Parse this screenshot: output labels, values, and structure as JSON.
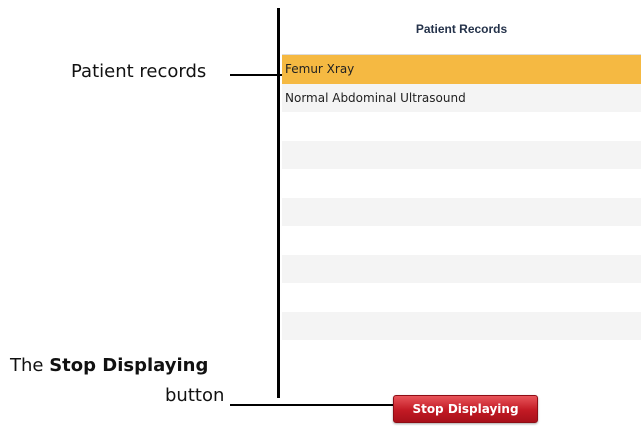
{
  "callouts": {
    "records_label": "Patient records",
    "stop_prefix": "The ",
    "stop_bold": "Stop Displaying",
    "stop_suffix": "button"
  },
  "panel": {
    "title": "Patient Records",
    "records": [
      {
        "label": "Femur Xray",
        "selected": true
      },
      {
        "label": "Normal Abdominal Ultrasound",
        "selected": false
      },
      {
        "label": "",
        "selected": false
      },
      {
        "label": "",
        "selected": false
      },
      {
        "label": "",
        "selected": false
      },
      {
        "label": "",
        "selected": false
      },
      {
        "label": "",
        "selected": false
      },
      {
        "label": "",
        "selected": false
      },
      {
        "label": "",
        "selected": false
      },
      {
        "label": "",
        "selected": false
      },
      {
        "label": "",
        "selected": false
      }
    ],
    "stop_button_label": "Stop Displaying",
    "selected_color": "#f5b942",
    "button_color": "#c21a24"
  }
}
